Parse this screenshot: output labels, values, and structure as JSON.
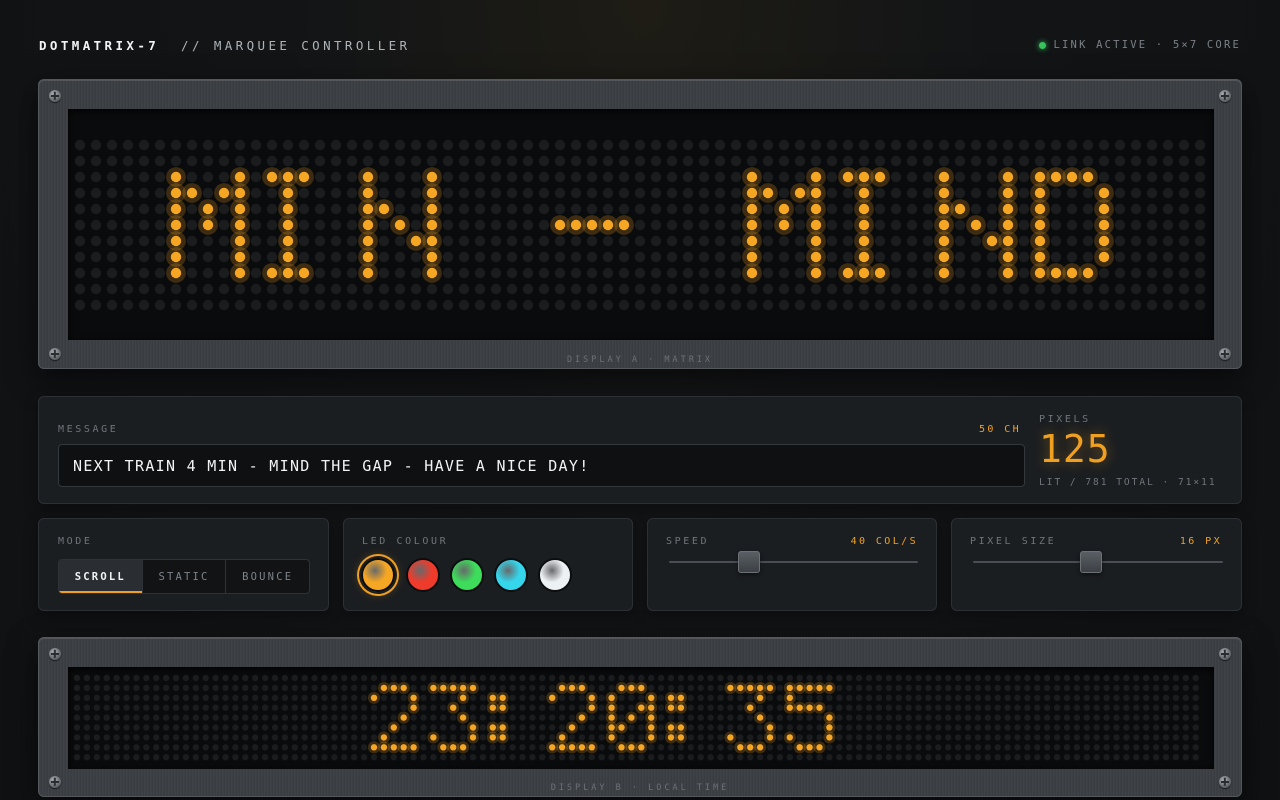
{
  "header": {
    "brand": "DOTMATRIX-7",
    "subtitle": "// MARQUEE CONTROLLER",
    "status": "LINK ACTIVE · 5×7 CORE"
  },
  "display_a": {
    "text": "MIN - MIND",
    "caption": "DISPLAY A · MATRIX"
  },
  "message": {
    "label": "MESSAGE",
    "count": "50 CH",
    "value": "NEXT TRAIN 4 MIN - MIND THE GAP - HAVE A NICE DAY!"
  },
  "pixels": {
    "label": "PIXELS",
    "value": "125",
    "detail": "LIT / 781 TOTAL · 71×11"
  },
  "mode": {
    "label": "MODE",
    "options": [
      "SCROLL",
      "STATIC",
      "BOUNCE"
    ],
    "selected": "SCROLL"
  },
  "led_colour": {
    "label": "LED COLOUR",
    "options": [
      {
        "name": "amber",
        "hex": "#f5a623"
      },
      {
        "name": "red",
        "hex": "#ef3b2c"
      },
      {
        "name": "green",
        "hex": "#3ddc5a"
      },
      {
        "name": "cyan",
        "hex": "#35d6ec"
      },
      {
        "name": "white",
        "hex": "#eef1f4"
      }
    ],
    "selected": "amber"
  },
  "speed": {
    "label": "SPEED",
    "value_text": "40 COL/S",
    "level": 0.32
  },
  "pixel_size": {
    "label": "PIXEL SIZE",
    "value_text": "16 PX",
    "level": 0.47
  },
  "display_b": {
    "text": "23:20:35",
    "caption": "DISPLAY B · LOCAL TIME"
  },
  "colors": {
    "led_on": "#f5a623",
    "led_off": "#1a1c1e",
    "accent": "#f0a020"
  }
}
